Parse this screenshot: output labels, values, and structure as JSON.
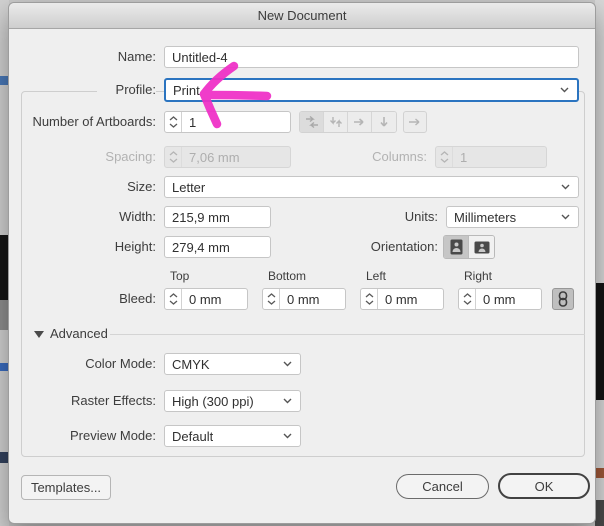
{
  "window": {
    "title": "New Document"
  },
  "form": {
    "name": {
      "label": "Name:",
      "value": "Untitled-4"
    },
    "profile": {
      "label": "Profile:",
      "value": "Print"
    },
    "artboards": {
      "label": "Number of Artboards:",
      "value": "1"
    },
    "spacing": {
      "label": "Spacing:",
      "value": "7,06 mm"
    },
    "columns": {
      "label": "Columns:",
      "value": "1"
    },
    "size": {
      "label": "Size:",
      "value": "Letter"
    },
    "width": {
      "label": "Width:",
      "value": "215,9 mm"
    },
    "units": {
      "label": "Units:",
      "value": "Millimeters"
    },
    "height": {
      "label": "Height:",
      "value": "279,4 mm"
    },
    "orientation": {
      "label": "Orientation:"
    },
    "bleed": {
      "label": "Bleed:",
      "fields": [
        {
          "label": "Top",
          "value": "0 mm"
        },
        {
          "label": "Bottom",
          "value": "0 mm"
        },
        {
          "label": "Left",
          "value": "0 mm"
        },
        {
          "label": "Right",
          "value": "0 mm"
        }
      ]
    },
    "advanced_section": {
      "label": "Advanced"
    },
    "color_mode": {
      "label": "Color Mode:",
      "value": "CMYK"
    },
    "raster_effects": {
      "label": "Raster Effects:",
      "value": "High (300 ppi)"
    },
    "preview_mode": {
      "label": "Preview Mode:",
      "value": "Default"
    }
  },
  "buttons": {
    "templates": "Templates...",
    "cancel": "Cancel",
    "ok": "OK"
  },
  "colors": {
    "focus_ring": "#2b74c0",
    "annotation_arrow": "#ef2ec6",
    "dialog_bg": "#efefef"
  },
  "annotation": {
    "type": "hand-drawn-arrow",
    "points_at": "Profile dropdown"
  }
}
